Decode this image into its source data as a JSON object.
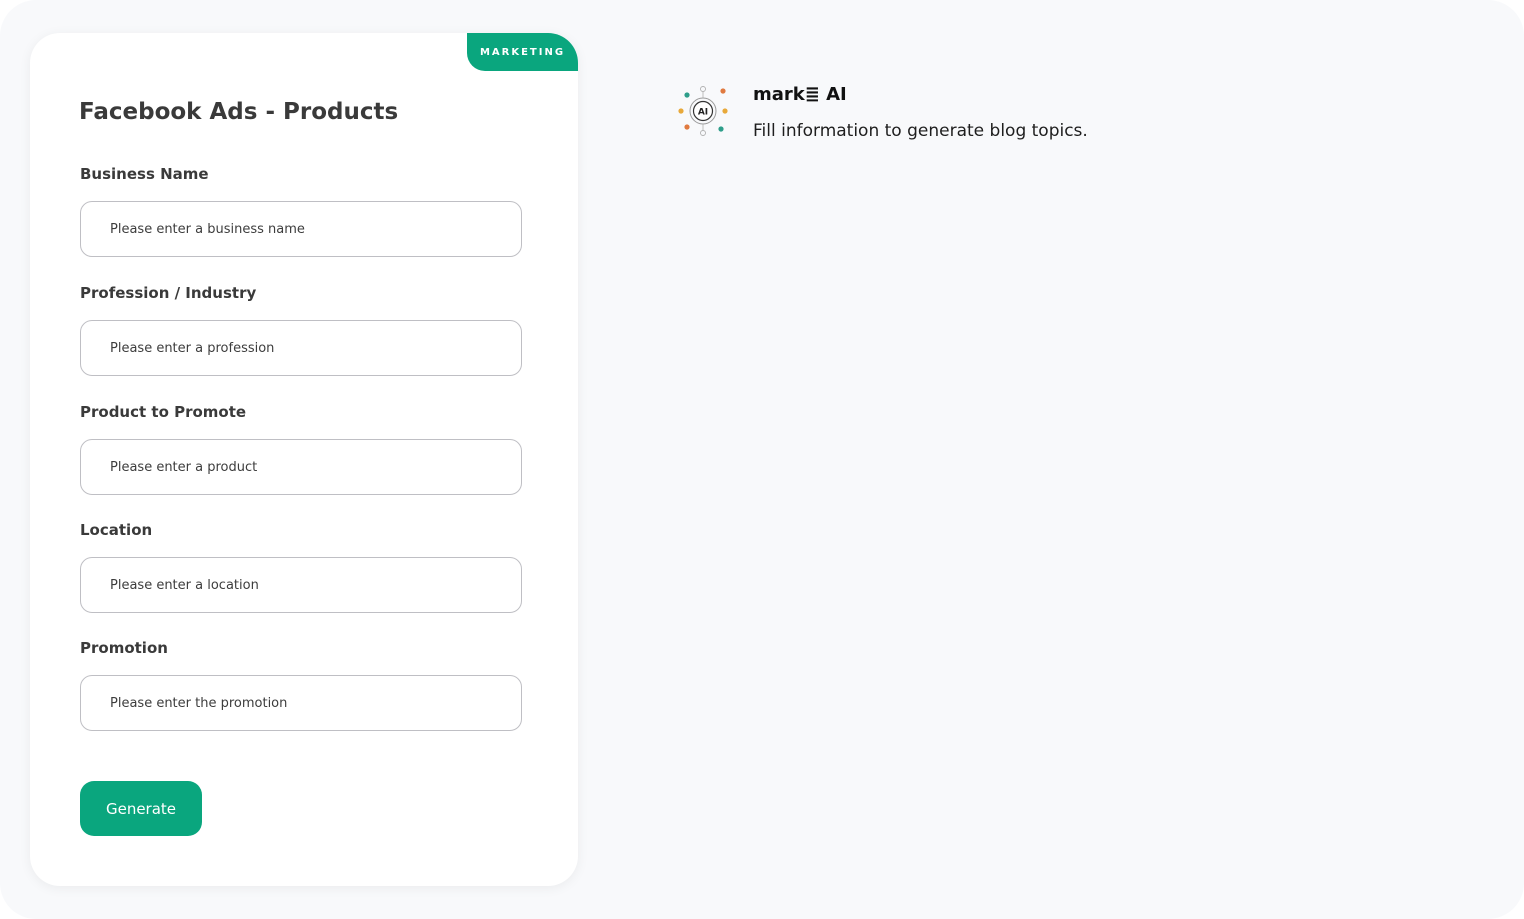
{
  "form": {
    "badge": "MARKETING",
    "title": "Facebook Ads - Products",
    "fields": [
      {
        "label": "Business Name",
        "placeholder": "Please enter a business name"
      },
      {
        "label": "Profession / Industry",
        "placeholder": "Please enter a profession"
      },
      {
        "label": "Product to Promote",
        "placeholder": "Please enter a product"
      },
      {
        "label": "Location",
        "placeholder": "Please enter a location"
      },
      {
        "label": "Promotion",
        "placeholder": "Please enter the promotion"
      }
    ],
    "submit_label": "Generate"
  },
  "assistant": {
    "logo_text": "AI",
    "logo_icon": "ai-sparkle-icon",
    "name": "mark≣ AI",
    "message": "Fill information to generate blog topics."
  },
  "colors": {
    "accent": "#0aa67e",
    "background": "#f8f9fb",
    "card": "#ffffff",
    "logo_orange": "#e07a3f",
    "logo_teal": "#2e9e8a",
    "logo_yellow": "#e8a93a"
  }
}
